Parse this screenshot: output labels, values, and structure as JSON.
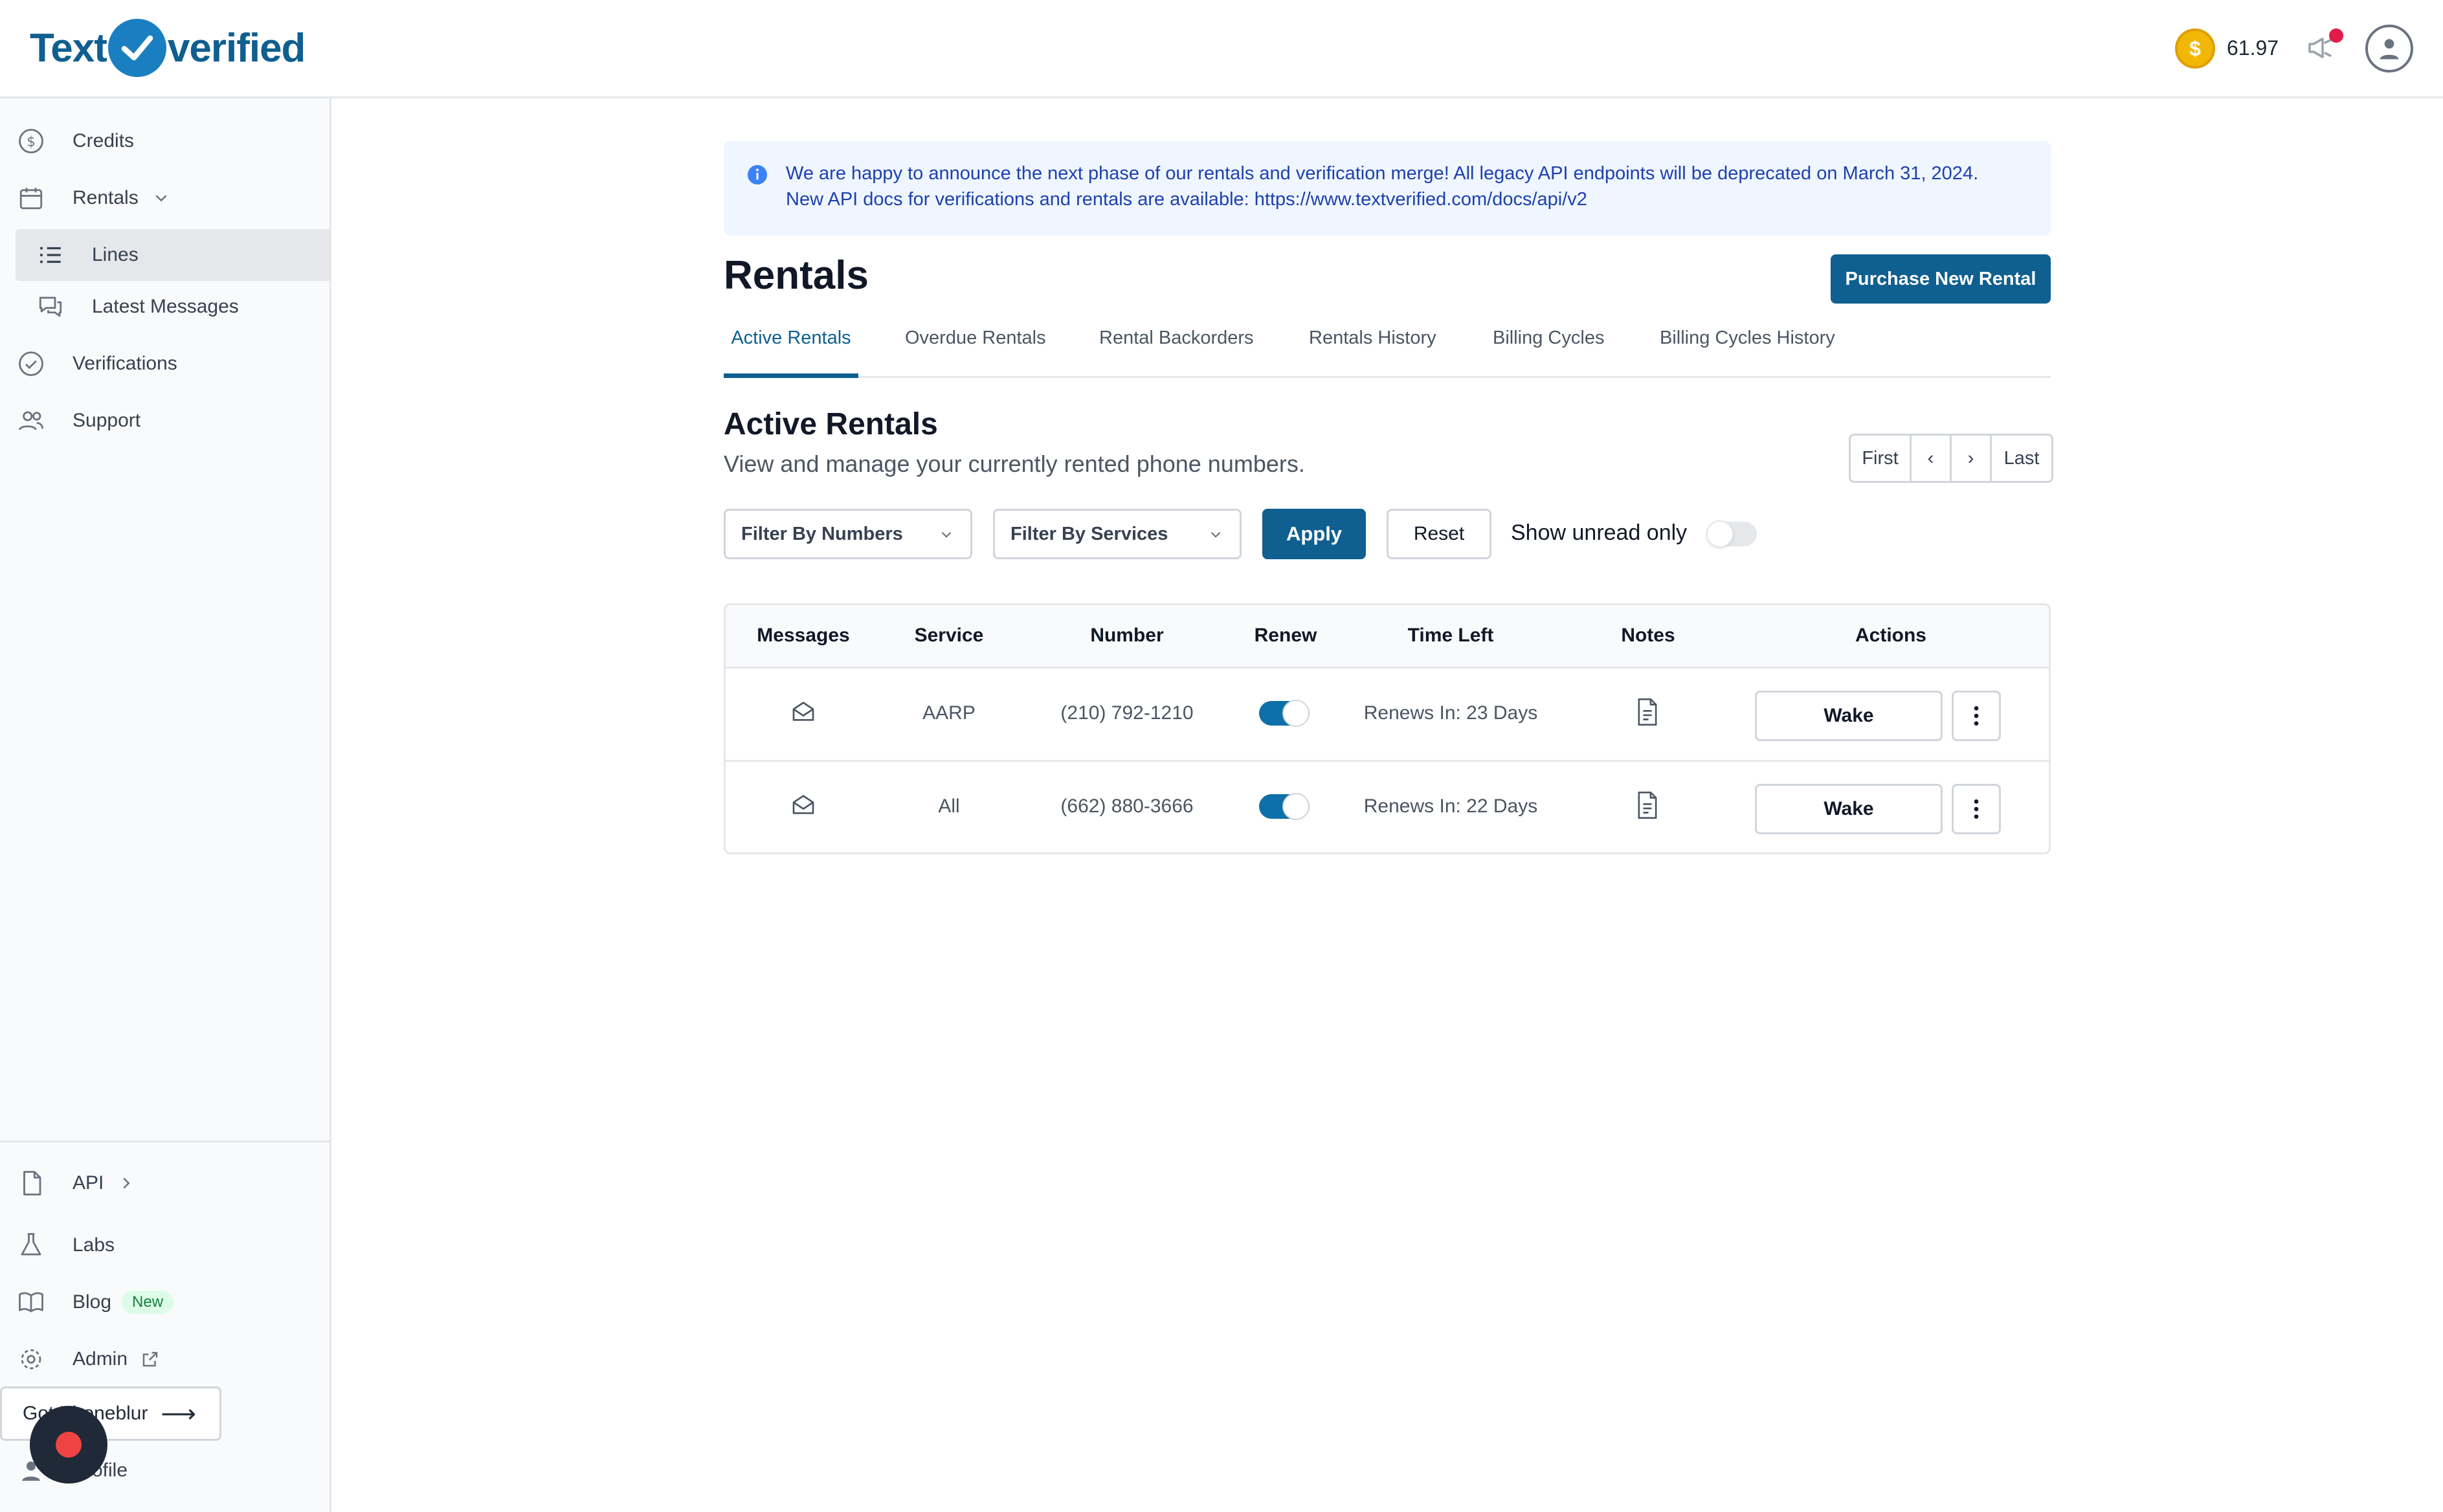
{
  "header": {
    "logo_left": "Text",
    "logo_right": "verified",
    "credits_value": "61.97",
    "coin_symbol": "$"
  },
  "sidebar": {
    "items": [
      {
        "label": "Credits"
      },
      {
        "label": "Rentals"
      },
      {
        "label": "Lines"
      },
      {
        "label": "Latest Messages"
      },
      {
        "label": "Verifications"
      },
      {
        "label": "Support"
      }
    ],
    "bottom_items": [
      {
        "label": "API"
      },
      {
        "label": "Labs"
      },
      {
        "label": "Blog",
        "badge": "New"
      },
      {
        "label": "Admin"
      },
      {
        "label": "Profile"
      }
    ],
    "phoneblur_label": "Got Phoneblur",
    "phoneblur_arrow": "⟶"
  },
  "banner": {
    "line1": "We are happy to announce the next phase of our rentals and verification merge! All legacy API endpoints will be deprecated on March 31, 2024.",
    "line2": "New API docs for verifications and rentals are available: https://www.textverified.com/docs/api/v2"
  },
  "page": {
    "title": "Rentals",
    "purchase_button": "Purchase New Rental"
  },
  "tabs": [
    {
      "label": "Active Rentals",
      "active": true
    },
    {
      "label": "Overdue Rentals"
    },
    {
      "label": "Rental Backorders"
    },
    {
      "label": "Rentals History"
    },
    {
      "label": "Billing Cycles"
    },
    {
      "label": "Billing Cycles History"
    }
  ],
  "section": {
    "title": "Active Rentals",
    "subtitle": "View and manage your currently rented phone numbers."
  },
  "pager": {
    "first": "First",
    "prev": "‹",
    "next": "›",
    "last": "Last"
  },
  "filters": {
    "numbers_placeholder": "Filter By Numbers",
    "services_placeholder": "Filter By Services",
    "apply": "Apply",
    "reset": "Reset",
    "unread_label": "Show unread only",
    "unread_on": false
  },
  "table": {
    "columns": [
      "Messages",
      "Service",
      "Number",
      "Renew",
      "Time Left",
      "Notes",
      "Actions"
    ],
    "rows": [
      {
        "service": "AARP",
        "number": "(210) 792-1210",
        "renew": true,
        "time_left": "Renews In: 23 Days",
        "action": "Wake"
      },
      {
        "service": "All",
        "number": "(662) 880-3666",
        "renew": true,
        "time_left": "Renews In: 22 Days",
        "action": "Wake"
      }
    ]
  },
  "colors": {
    "brand": "#0f5f90",
    "alert_bg": "#eff6ff",
    "alert_text": "#1e40af",
    "notification_dot": "#e11d48",
    "coin": "#f2b705"
  }
}
